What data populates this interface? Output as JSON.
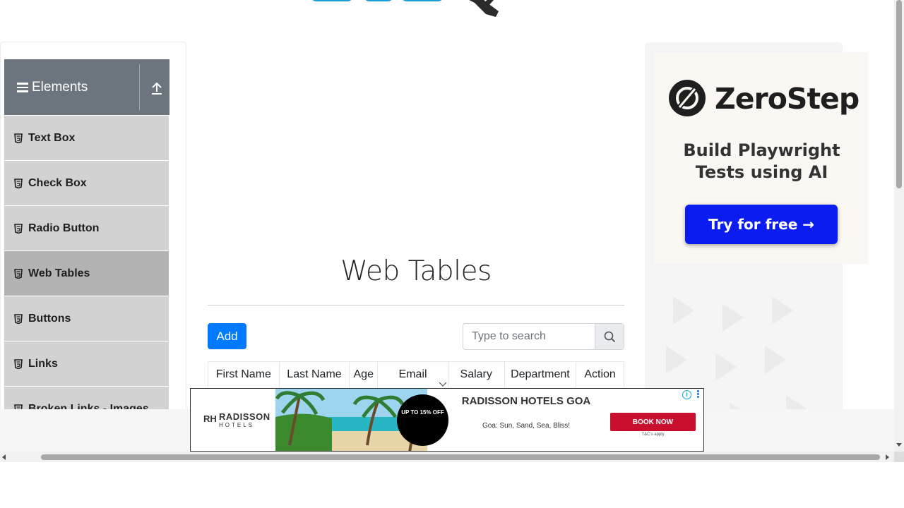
{
  "sidebar": {
    "group_title": "Elements",
    "items": [
      {
        "label": "Text Box",
        "icon": "html5-icon"
      },
      {
        "label": "Check Box",
        "icon": "html5-icon"
      },
      {
        "label": "Radio Button",
        "icon": "html5-icon"
      },
      {
        "label": "Web Tables",
        "icon": "html5-icon",
        "active": true
      },
      {
        "label": "Buttons",
        "icon": "html5-icon"
      },
      {
        "label": "Links",
        "icon": "html5-icon"
      },
      {
        "label": "Broken Links - Images",
        "icon": "html5-icon"
      }
    ]
  },
  "main": {
    "title": "Web Tables",
    "add_label": "Add",
    "search": {
      "placeholder": "Type to search"
    },
    "columns": [
      "First Name",
      "Last Name",
      "Age",
      "Email",
      "Salary",
      "Department",
      "Action"
    ]
  },
  "ad_right": {
    "brand": "ZeroStep",
    "tagline": "Build Playwright Tests using AI",
    "cta": "Try for free →"
  },
  "ad_bottom": {
    "brand_top": "RADISSON",
    "brand_bottom": "HOTELS",
    "badge": "UP TO 15% OFF",
    "headline": "RADISSON HOTELS GOA",
    "subline": "Goa: Sun, Sand, Sea, Bliss!",
    "cta": "BOOK NOW",
    "terms": "T&C's apply"
  },
  "colors": {
    "primary_button": "#007bff",
    "sidebar_header": "#6c757d",
    "menu_item": "#d2d2d2",
    "menu_item_active": "#b3b3b3",
    "zerostep_cta": "#0a1cf0",
    "radisson_cta": "#c8102e"
  }
}
